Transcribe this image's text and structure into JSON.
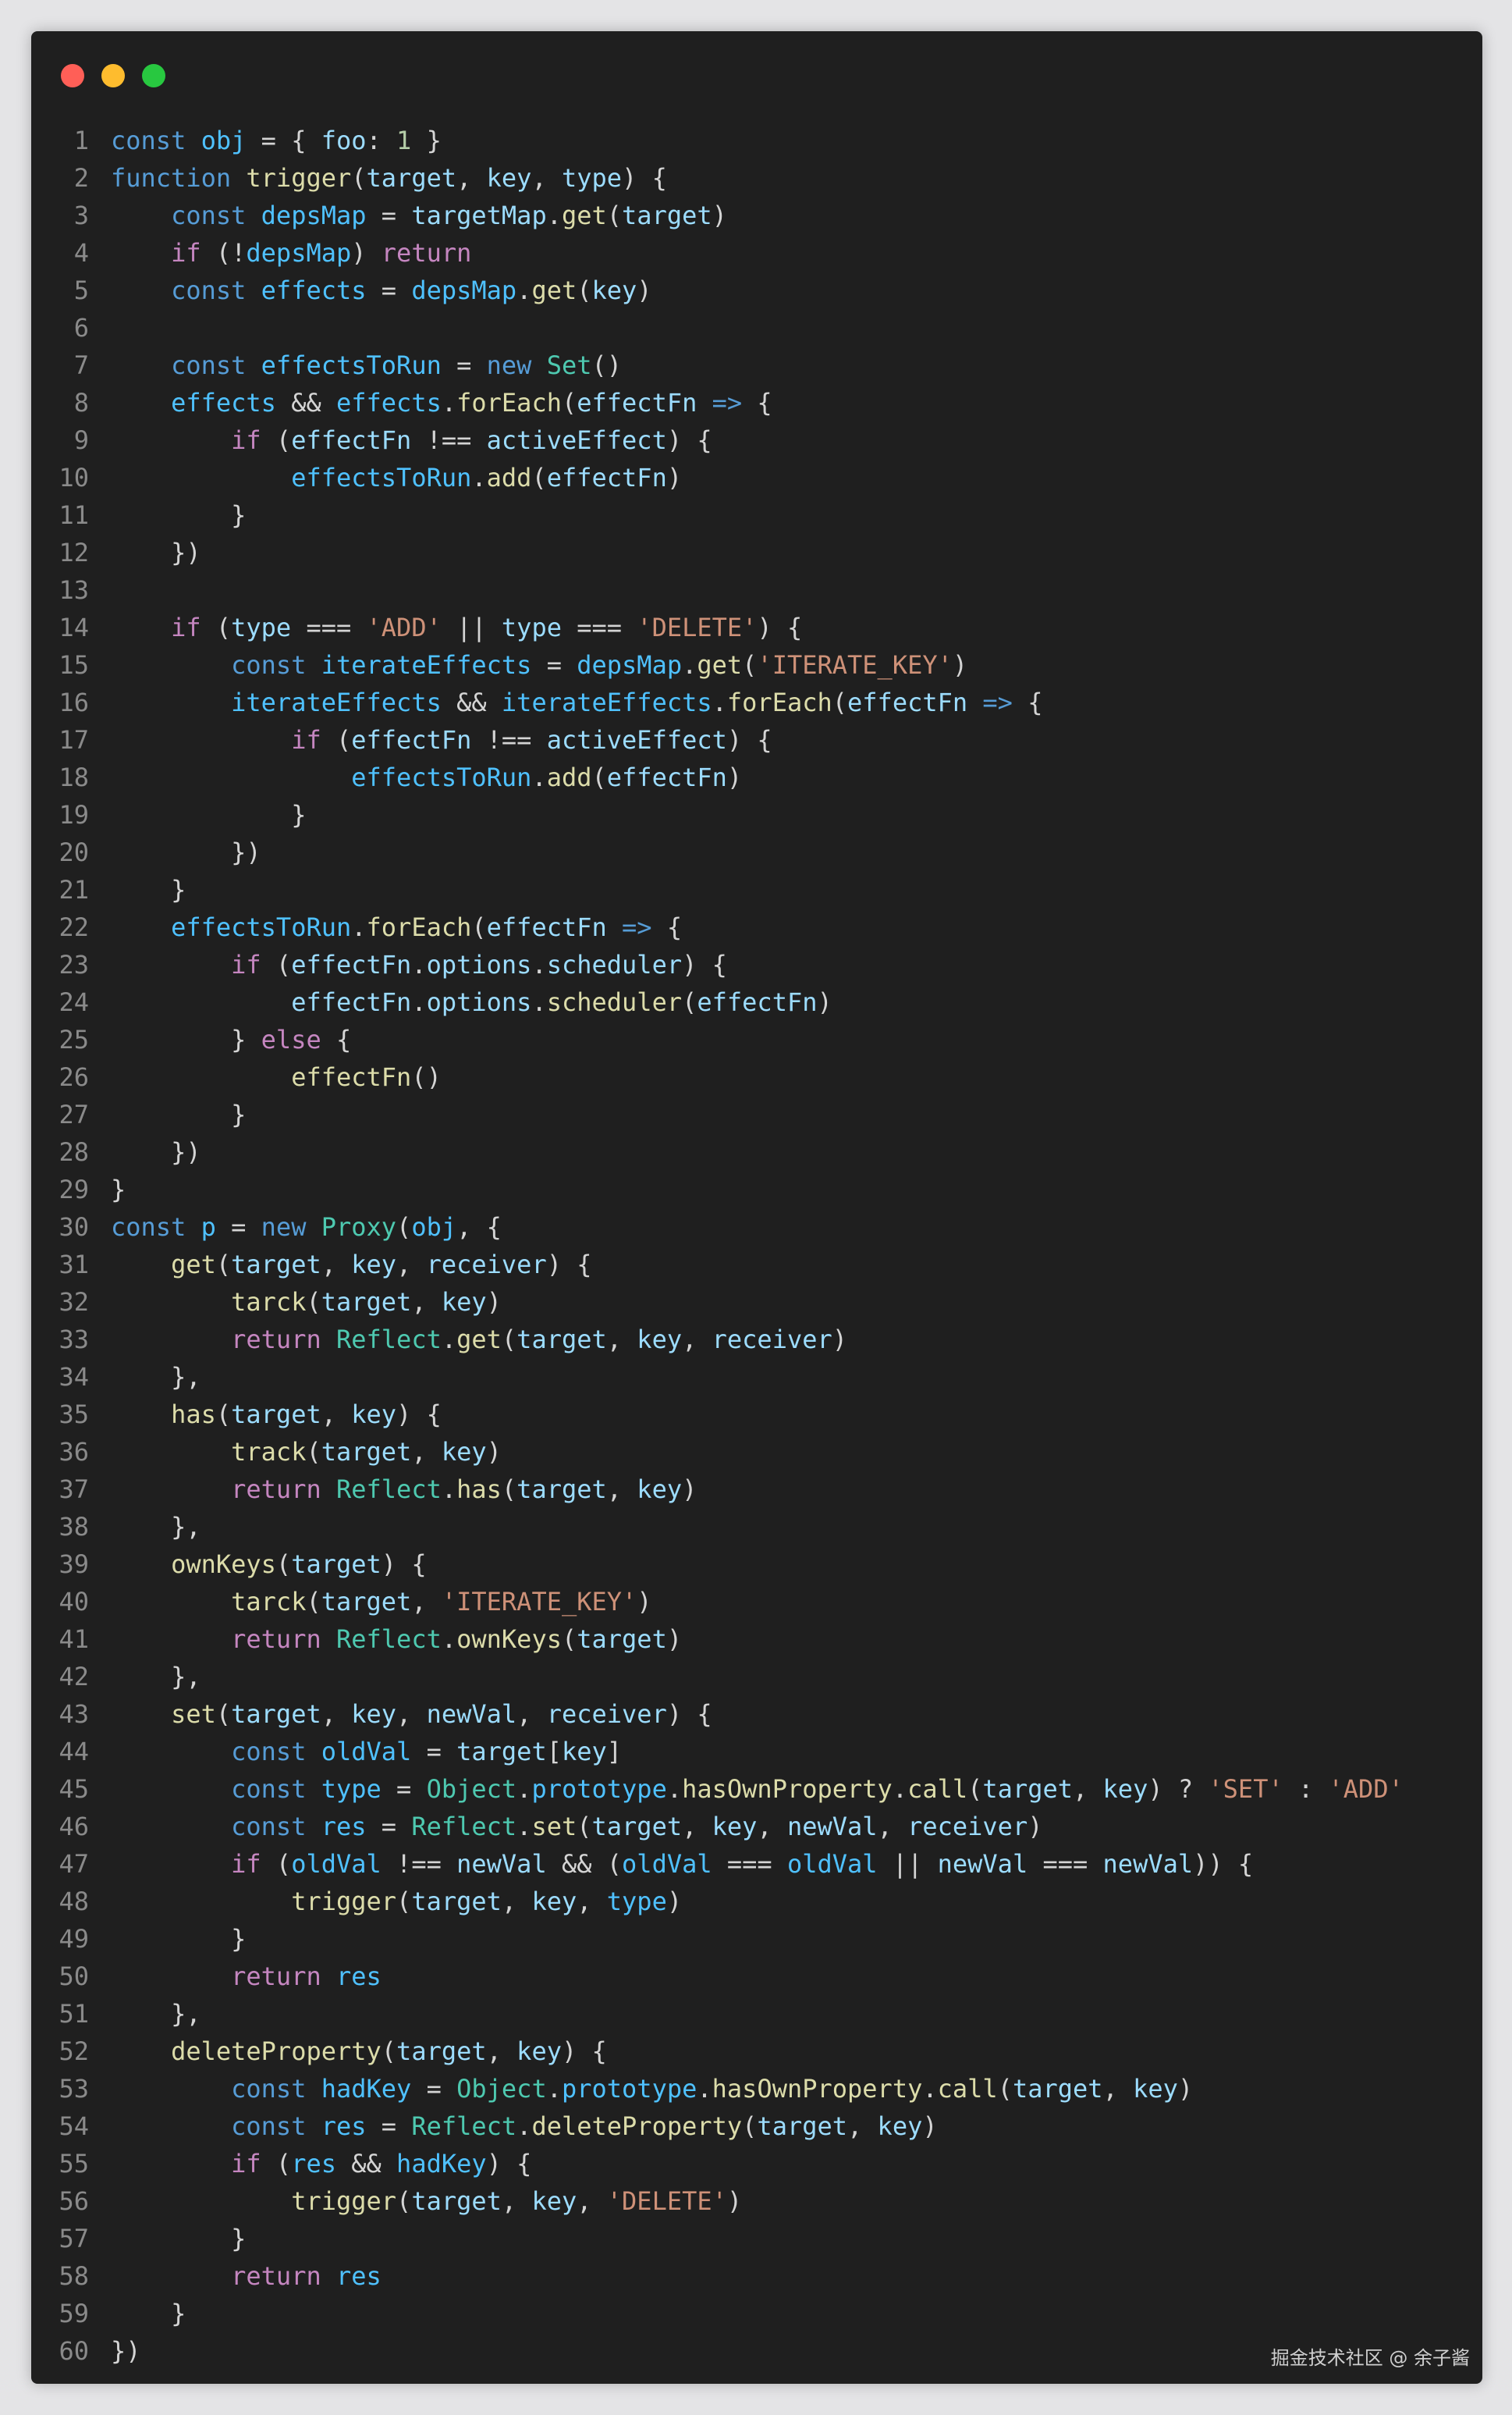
{
  "window": {
    "buttons": [
      {
        "name": "close",
        "color": "#ff5f57"
      },
      {
        "name": "minimize",
        "color": "#febc2e"
      },
      {
        "name": "maximize",
        "color": "#28c840"
      }
    ]
  },
  "theme": {
    "keyword": "#569cd6",
    "control": "#c586c0",
    "function": "#dcdcaa",
    "variable": "#9cdcfe",
    "constant": "#4fc1ff",
    "string": "#ce9178",
    "number": "#b5cea8",
    "type": "#4ec9b0",
    "plain": "#d4d4d4",
    "line_number": "#8a8a8a"
  },
  "code_lines": [
    [
      [
        "kw",
        "const "
      ],
      [
        "const",
        "obj"
      ],
      [
        "p",
        " = { "
      ],
      [
        "var",
        "foo"
      ],
      [
        "p",
        ": "
      ],
      [
        "num",
        "1"
      ],
      [
        "p",
        " }"
      ]
    ],
    [
      [
        "kw",
        "function "
      ],
      [
        "fn",
        "trigger"
      ],
      [
        "p",
        "("
      ],
      [
        "var",
        "target"
      ],
      [
        "p",
        ", "
      ],
      [
        "var",
        "key"
      ],
      [
        "p",
        ", "
      ],
      [
        "var",
        "type"
      ],
      [
        "p",
        ") {"
      ]
    ],
    [
      [
        "p",
        "    "
      ],
      [
        "kw",
        "const "
      ],
      [
        "const",
        "depsMap"
      ],
      [
        "p",
        " = "
      ],
      [
        "var",
        "targetMap"
      ],
      [
        "p",
        "."
      ],
      [
        "fn",
        "get"
      ],
      [
        "p",
        "("
      ],
      [
        "var",
        "target"
      ],
      [
        "p",
        ")"
      ]
    ],
    [
      [
        "p",
        "    "
      ],
      [
        "ctl",
        "if"
      ],
      [
        "p",
        " (!"
      ],
      [
        "const",
        "depsMap"
      ],
      [
        "p",
        ") "
      ],
      [
        "ctl",
        "return"
      ]
    ],
    [
      [
        "p",
        "    "
      ],
      [
        "kw",
        "const "
      ],
      [
        "const",
        "effects"
      ],
      [
        "p",
        " = "
      ],
      [
        "const",
        "depsMap"
      ],
      [
        "p",
        "."
      ],
      [
        "fn",
        "get"
      ],
      [
        "p",
        "("
      ],
      [
        "var",
        "key"
      ],
      [
        "p",
        ")"
      ]
    ],
    [],
    [
      [
        "p",
        "    "
      ],
      [
        "kw",
        "const "
      ],
      [
        "const",
        "effectsToRun"
      ],
      [
        "p",
        " = "
      ],
      [
        "kw",
        "new "
      ],
      [
        "type",
        "Set"
      ],
      [
        "p",
        "()"
      ]
    ],
    [
      [
        "p",
        "    "
      ],
      [
        "const",
        "effects"
      ],
      [
        "p",
        " && "
      ],
      [
        "const",
        "effects"
      ],
      [
        "p",
        "."
      ],
      [
        "fn",
        "forEach"
      ],
      [
        "p",
        "("
      ],
      [
        "var",
        "effectFn"
      ],
      [
        "kw",
        " =>"
      ],
      [
        "p",
        " {"
      ]
    ],
    [
      [
        "p",
        "        "
      ],
      [
        "ctl",
        "if"
      ],
      [
        "p",
        " ("
      ],
      [
        "var",
        "effectFn"
      ],
      [
        "p",
        " !== "
      ],
      [
        "var",
        "activeEffect"
      ],
      [
        "p",
        ") {"
      ]
    ],
    [
      [
        "p",
        "            "
      ],
      [
        "const",
        "effectsToRun"
      ],
      [
        "p",
        "."
      ],
      [
        "fn",
        "add"
      ],
      [
        "p",
        "("
      ],
      [
        "var",
        "effectFn"
      ],
      [
        "p",
        ")"
      ]
    ],
    [
      [
        "p",
        "        }"
      ]
    ],
    [
      [
        "p",
        "    })"
      ]
    ],
    [],
    [
      [
        "p",
        "    "
      ],
      [
        "ctl",
        "if"
      ],
      [
        "p",
        " ("
      ],
      [
        "var",
        "type"
      ],
      [
        "p",
        " === "
      ],
      [
        "str",
        "'ADD'"
      ],
      [
        "p",
        " || "
      ],
      [
        "var",
        "type"
      ],
      [
        "p",
        " === "
      ],
      [
        "str",
        "'DELETE'"
      ],
      [
        "p",
        ") {"
      ]
    ],
    [
      [
        "p",
        "        "
      ],
      [
        "kw",
        "const "
      ],
      [
        "const",
        "iterateEffects"
      ],
      [
        "p",
        " = "
      ],
      [
        "const",
        "depsMap"
      ],
      [
        "p",
        "."
      ],
      [
        "fn",
        "get"
      ],
      [
        "p",
        "("
      ],
      [
        "str",
        "'ITERATE_KEY'"
      ],
      [
        "p",
        ")"
      ]
    ],
    [
      [
        "p",
        "        "
      ],
      [
        "const",
        "iterateEffects"
      ],
      [
        "p",
        " && "
      ],
      [
        "const",
        "iterateEffects"
      ],
      [
        "p",
        "."
      ],
      [
        "fn",
        "forEach"
      ],
      [
        "p",
        "("
      ],
      [
        "var",
        "effectFn"
      ],
      [
        "kw",
        " =>"
      ],
      [
        "p",
        " {"
      ]
    ],
    [
      [
        "p",
        "            "
      ],
      [
        "ctl",
        "if"
      ],
      [
        "p",
        " ("
      ],
      [
        "var",
        "effectFn"
      ],
      [
        "p",
        " !== "
      ],
      [
        "var",
        "activeEffect"
      ],
      [
        "p",
        ") {"
      ]
    ],
    [
      [
        "p",
        "                "
      ],
      [
        "const",
        "effectsToRun"
      ],
      [
        "p",
        "."
      ],
      [
        "fn",
        "add"
      ],
      [
        "p",
        "("
      ],
      [
        "var",
        "effectFn"
      ],
      [
        "p",
        ")"
      ]
    ],
    [
      [
        "p",
        "            }"
      ]
    ],
    [
      [
        "p",
        "        })"
      ]
    ],
    [
      [
        "p",
        "    }"
      ]
    ],
    [
      [
        "p",
        "    "
      ],
      [
        "const",
        "effectsToRun"
      ],
      [
        "p",
        "."
      ],
      [
        "fn",
        "forEach"
      ],
      [
        "p",
        "("
      ],
      [
        "var",
        "effectFn"
      ],
      [
        "kw",
        " =>"
      ],
      [
        "p",
        " {"
      ]
    ],
    [
      [
        "p",
        "        "
      ],
      [
        "ctl",
        "if"
      ],
      [
        "p",
        " ("
      ],
      [
        "var",
        "effectFn"
      ],
      [
        "p",
        "."
      ],
      [
        "var",
        "options"
      ],
      [
        "p",
        "."
      ],
      [
        "var",
        "scheduler"
      ],
      [
        "p",
        ") {"
      ]
    ],
    [
      [
        "p",
        "            "
      ],
      [
        "var",
        "effectFn"
      ],
      [
        "p",
        "."
      ],
      [
        "var",
        "options"
      ],
      [
        "p",
        "."
      ],
      [
        "fn",
        "scheduler"
      ],
      [
        "p",
        "("
      ],
      [
        "var",
        "effectFn"
      ],
      [
        "p",
        ")"
      ]
    ],
    [
      [
        "p",
        "        } "
      ],
      [
        "ctl",
        "else"
      ],
      [
        "p",
        " {"
      ]
    ],
    [
      [
        "p",
        "            "
      ],
      [
        "fn",
        "effectFn"
      ],
      [
        "p",
        "()"
      ]
    ],
    [
      [
        "p",
        "        }"
      ]
    ],
    [
      [
        "p",
        "    })"
      ]
    ],
    [
      [
        "p",
        "}"
      ]
    ],
    [
      [
        "kw",
        "const "
      ],
      [
        "const",
        "p"
      ],
      [
        "p",
        " = "
      ],
      [
        "kw",
        "new "
      ],
      [
        "type",
        "Proxy"
      ],
      [
        "p",
        "("
      ],
      [
        "const",
        "obj"
      ],
      [
        "p",
        ", {"
      ]
    ],
    [
      [
        "p",
        "    "
      ],
      [
        "fn",
        "get"
      ],
      [
        "p",
        "("
      ],
      [
        "var",
        "target"
      ],
      [
        "p",
        ", "
      ],
      [
        "var",
        "key"
      ],
      [
        "p",
        ", "
      ],
      [
        "var",
        "receiver"
      ],
      [
        "p",
        ") {"
      ]
    ],
    [
      [
        "p",
        "        "
      ],
      [
        "fn",
        "tarck"
      ],
      [
        "p",
        "("
      ],
      [
        "var",
        "target"
      ],
      [
        "p",
        ", "
      ],
      [
        "var",
        "key"
      ],
      [
        "p",
        ")"
      ]
    ],
    [
      [
        "p",
        "        "
      ],
      [
        "ctl",
        "return "
      ],
      [
        "type",
        "Reflect"
      ],
      [
        "p",
        "."
      ],
      [
        "fn",
        "get"
      ],
      [
        "p",
        "("
      ],
      [
        "var",
        "target"
      ],
      [
        "p",
        ", "
      ],
      [
        "var",
        "key"
      ],
      [
        "p",
        ", "
      ],
      [
        "var",
        "receiver"
      ],
      [
        "p",
        ")"
      ]
    ],
    [
      [
        "p",
        "    },"
      ]
    ],
    [
      [
        "p",
        "    "
      ],
      [
        "fn",
        "has"
      ],
      [
        "p",
        "("
      ],
      [
        "var",
        "target"
      ],
      [
        "p",
        ", "
      ],
      [
        "var",
        "key"
      ],
      [
        "p",
        ") {"
      ]
    ],
    [
      [
        "p",
        "        "
      ],
      [
        "fn",
        "track"
      ],
      [
        "p",
        "("
      ],
      [
        "var",
        "target"
      ],
      [
        "p",
        ", "
      ],
      [
        "var",
        "key"
      ],
      [
        "p",
        ")"
      ]
    ],
    [
      [
        "p",
        "        "
      ],
      [
        "ctl",
        "return "
      ],
      [
        "type",
        "Reflect"
      ],
      [
        "p",
        "."
      ],
      [
        "fn",
        "has"
      ],
      [
        "p",
        "("
      ],
      [
        "var",
        "target"
      ],
      [
        "p",
        ", "
      ],
      [
        "var",
        "key"
      ],
      [
        "p",
        ")"
      ]
    ],
    [
      [
        "p",
        "    },"
      ]
    ],
    [
      [
        "p",
        "    "
      ],
      [
        "fn",
        "ownKeys"
      ],
      [
        "p",
        "("
      ],
      [
        "var",
        "target"
      ],
      [
        "p",
        ") {"
      ]
    ],
    [
      [
        "p",
        "        "
      ],
      [
        "fn",
        "tarck"
      ],
      [
        "p",
        "("
      ],
      [
        "var",
        "target"
      ],
      [
        "p",
        ", "
      ],
      [
        "str",
        "'ITERATE_KEY'"
      ],
      [
        "p",
        ")"
      ]
    ],
    [
      [
        "p",
        "        "
      ],
      [
        "ctl",
        "return "
      ],
      [
        "type",
        "Reflect"
      ],
      [
        "p",
        "."
      ],
      [
        "fn",
        "ownKeys"
      ],
      [
        "p",
        "("
      ],
      [
        "var",
        "target"
      ],
      [
        "p",
        ")"
      ]
    ],
    [
      [
        "p",
        "    },"
      ]
    ],
    [
      [
        "p",
        "    "
      ],
      [
        "fn",
        "set"
      ],
      [
        "p",
        "("
      ],
      [
        "var",
        "target"
      ],
      [
        "p",
        ", "
      ],
      [
        "var",
        "key"
      ],
      [
        "p",
        ", "
      ],
      [
        "var",
        "newVal"
      ],
      [
        "p",
        ", "
      ],
      [
        "var",
        "receiver"
      ],
      [
        "p",
        ") {"
      ]
    ],
    [
      [
        "p",
        "        "
      ],
      [
        "kw",
        "const "
      ],
      [
        "const",
        "oldVal"
      ],
      [
        "p",
        " = "
      ],
      [
        "var",
        "target"
      ],
      [
        "p",
        "["
      ],
      [
        "var",
        "key"
      ],
      [
        "p",
        "]"
      ]
    ],
    [
      [
        "p",
        "        "
      ],
      [
        "kw",
        "const "
      ],
      [
        "const",
        "type"
      ],
      [
        "p",
        " = "
      ],
      [
        "type",
        "Object"
      ],
      [
        "p",
        "."
      ],
      [
        "const",
        "prototype"
      ],
      [
        "p",
        "."
      ],
      [
        "fn",
        "hasOwnProperty"
      ],
      [
        "p",
        "."
      ],
      [
        "fn",
        "call"
      ],
      [
        "p",
        "("
      ],
      [
        "var",
        "target"
      ],
      [
        "p",
        ", "
      ],
      [
        "var",
        "key"
      ],
      [
        "p",
        ") ? "
      ],
      [
        "str",
        "'SET'"
      ],
      [
        "p",
        " : "
      ],
      [
        "str",
        "'ADD'"
      ]
    ],
    [
      [
        "p",
        "        "
      ],
      [
        "kw",
        "const "
      ],
      [
        "const",
        "res"
      ],
      [
        "p",
        " = "
      ],
      [
        "type",
        "Reflect"
      ],
      [
        "p",
        "."
      ],
      [
        "fn",
        "set"
      ],
      [
        "p",
        "("
      ],
      [
        "var",
        "target"
      ],
      [
        "p",
        ", "
      ],
      [
        "var",
        "key"
      ],
      [
        "p",
        ", "
      ],
      [
        "var",
        "newVal"
      ],
      [
        "p",
        ", "
      ],
      [
        "var",
        "receiver"
      ],
      [
        "p",
        ")"
      ]
    ],
    [
      [
        "p",
        "        "
      ],
      [
        "ctl",
        "if"
      ],
      [
        "p",
        " ("
      ],
      [
        "const",
        "oldVal"
      ],
      [
        "p",
        " !== "
      ],
      [
        "var",
        "newVal"
      ],
      [
        "p",
        " && ("
      ],
      [
        "const",
        "oldVal"
      ],
      [
        "p",
        " === "
      ],
      [
        "const",
        "oldVal"
      ],
      [
        "p",
        " || "
      ],
      [
        "var",
        "newVal"
      ],
      [
        "p",
        " === "
      ],
      [
        "var",
        "newVal"
      ],
      [
        "p",
        ")) {"
      ]
    ],
    [
      [
        "p",
        "            "
      ],
      [
        "fn",
        "trigger"
      ],
      [
        "p",
        "("
      ],
      [
        "var",
        "target"
      ],
      [
        "p",
        ", "
      ],
      [
        "var",
        "key"
      ],
      [
        "p",
        ", "
      ],
      [
        "const",
        "type"
      ],
      [
        "p",
        ")"
      ]
    ],
    [
      [
        "p",
        "        }"
      ]
    ],
    [
      [
        "p",
        "        "
      ],
      [
        "ctl",
        "return "
      ],
      [
        "const",
        "res"
      ]
    ],
    [
      [
        "p",
        "    },"
      ]
    ],
    [
      [
        "p",
        "    "
      ],
      [
        "fn",
        "deleteProperty"
      ],
      [
        "p",
        "("
      ],
      [
        "var",
        "target"
      ],
      [
        "p",
        ", "
      ],
      [
        "var",
        "key"
      ],
      [
        "p",
        ") {"
      ]
    ],
    [
      [
        "p",
        "        "
      ],
      [
        "kw",
        "const "
      ],
      [
        "const",
        "hadKey"
      ],
      [
        "p",
        " = "
      ],
      [
        "type",
        "Object"
      ],
      [
        "p",
        "."
      ],
      [
        "const",
        "prototype"
      ],
      [
        "p",
        "."
      ],
      [
        "fn",
        "hasOwnProperty"
      ],
      [
        "p",
        "."
      ],
      [
        "fn",
        "call"
      ],
      [
        "p",
        "("
      ],
      [
        "var",
        "target"
      ],
      [
        "p",
        ", "
      ],
      [
        "var",
        "key"
      ],
      [
        "p",
        ")"
      ]
    ],
    [
      [
        "p",
        "        "
      ],
      [
        "kw",
        "const "
      ],
      [
        "const",
        "res"
      ],
      [
        "p",
        " = "
      ],
      [
        "type",
        "Reflect"
      ],
      [
        "p",
        "."
      ],
      [
        "fn",
        "deleteProperty"
      ],
      [
        "p",
        "("
      ],
      [
        "var",
        "target"
      ],
      [
        "p",
        ", "
      ],
      [
        "var",
        "key"
      ],
      [
        "p",
        ")"
      ]
    ],
    [
      [
        "p",
        "        "
      ],
      [
        "ctl",
        "if"
      ],
      [
        "p",
        " ("
      ],
      [
        "const",
        "res"
      ],
      [
        "p",
        " && "
      ],
      [
        "const",
        "hadKey"
      ],
      [
        "p",
        ") {"
      ]
    ],
    [
      [
        "p",
        "            "
      ],
      [
        "fn",
        "trigger"
      ],
      [
        "p",
        "("
      ],
      [
        "var",
        "target"
      ],
      [
        "p",
        ", "
      ],
      [
        "var",
        "key"
      ],
      [
        "p",
        ", "
      ],
      [
        "str",
        "'DELETE'"
      ],
      [
        "p",
        ")"
      ]
    ],
    [
      [
        "p",
        "        }"
      ]
    ],
    [
      [
        "p",
        "        "
      ],
      [
        "ctl",
        "return "
      ],
      [
        "const",
        "res"
      ]
    ],
    [
      [
        "p",
        "    }"
      ]
    ],
    [
      [
        "p",
        "})"
      ]
    ]
  ],
  "watermark": "掘金技术社区 @ 余子酱"
}
